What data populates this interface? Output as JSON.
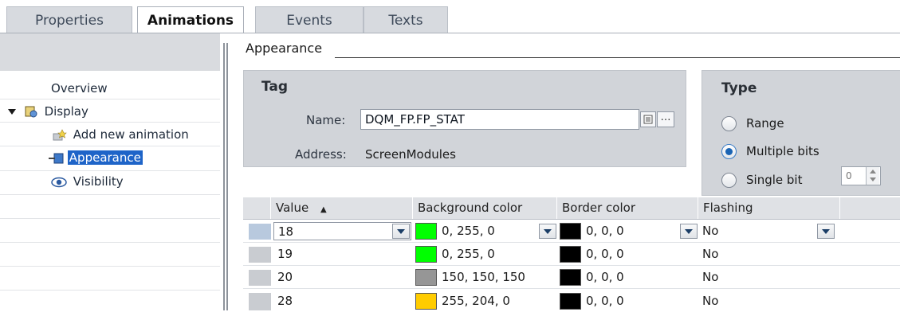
{
  "tabs": [
    "Properties",
    "Animations",
    "Events",
    "Texts"
  ],
  "active_tab": "Animations",
  "nav": {
    "items": [
      {
        "label": "Overview"
      },
      {
        "label": "Display",
        "expanded": true,
        "icon": "display-folder-icon"
      },
      {
        "label": "Add new animation",
        "icon": "add-animation-icon"
      },
      {
        "label": "Appearance",
        "selected": true,
        "icon": "appearance-icon"
      },
      {
        "label": "Visibility",
        "icon": "eye-icon"
      }
    ]
  },
  "section": {
    "title": "Appearance"
  },
  "tag": {
    "title": "Tag",
    "name_label": "Name:",
    "name_value": "DQM_FP.FP_STAT",
    "address_label": "Address:",
    "address_value": "ScreenModules"
  },
  "type": {
    "title": "Type",
    "options": [
      {
        "label": "Range",
        "checked": false
      },
      {
        "label": "Multiple bits",
        "checked": true
      },
      {
        "label": "Single bit",
        "checked": false
      }
    ],
    "single_bit_value": "0"
  },
  "table": {
    "headers": [
      "Value",
      "Background color",
      "Border color",
      "Flashing"
    ],
    "sort_indicator": "▲",
    "rows": [
      {
        "value": "18",
        "bg_color": "0, 255, 0",
        "bg_hex": "#00ff00",
        "border_color": "0, 0, 0",
        "border_hex": "#000000",
        "flashing": "No"
      },
      {
        "value": "19",
        "bg_color": "0, 255, 0",
        "bg_hex": "#00ff00",
        "border_color": "0, 0, 0",
        "border_hex": "#000000",
        "flashing": "No"
      },
      {
        "value": "20",
        "bg_color": "150, 150, 150",
        "bg_hex": "#969696",
        "border_color": "0, 0, 0",
        "border_hex": "#000000",
        "flashing": "No"
      },
      {
        "value": "28",
        "bg_color": "255, 204, 0",
        "bg_hex": "#ffcc00",
        "border_color": "0, 0, 0",
        "border_hex": "#000000",
        "flashing": "No"
      }
    ]
  },
  "colors": {
    "selection": "#1e64c8",
    "radio_dot": "#1a64b4"
  }
}
